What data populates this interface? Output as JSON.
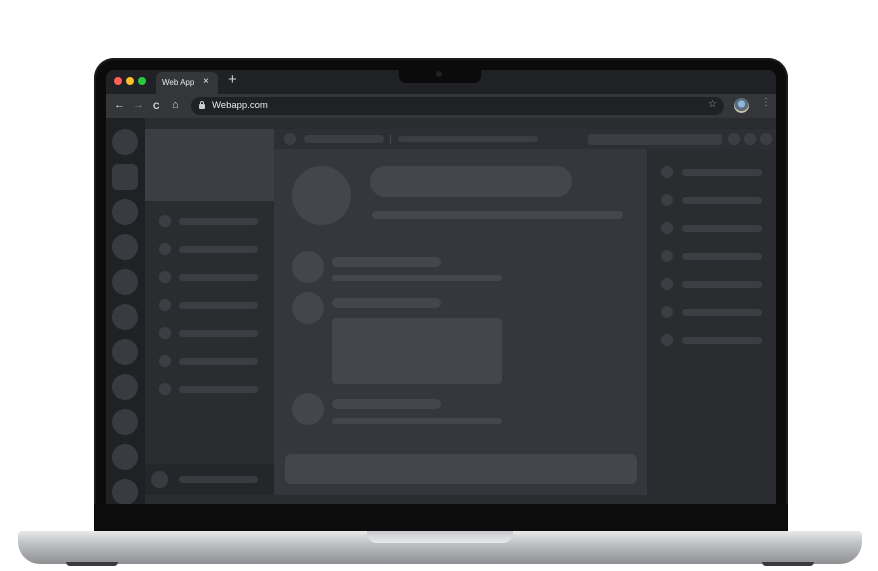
{
  "browser": {
    "tab_title": "Web App",
    "tab_close_glyph": "×",
    "new_tab_glyph": "+",
    "url": "Webapp.com",
    "back_glyph": "←",
    "forward_glyph": "→",
    "reload_glyph": "C",
    "home_glyph": "⌂",
    "bookmark_glyph": "☆",
    "menu_glyph": "⋮",
    "traffic_colors": {
      "close": "#ff5f57",
      "minimize": "#febc2e",
      "zoom": "#28c840"
    }
  },
  "theme": {
    "rail_bg": "#202124",
    "panel_bg": "#2b2c30",
    "main_bg": "#36373d",
    "skeleton": "#45464d",
    "laptop_silver": "#c9cbce"
  },
  "icons": [
    "back-arrow-icon",
    "forward-arrow-icon",
    "reload-icon",
    "home-icon",
    "lock-icon",
    "star-icon",
    "profile-avatar-icon",
    "kebab-menu-icon"
  ]
}
